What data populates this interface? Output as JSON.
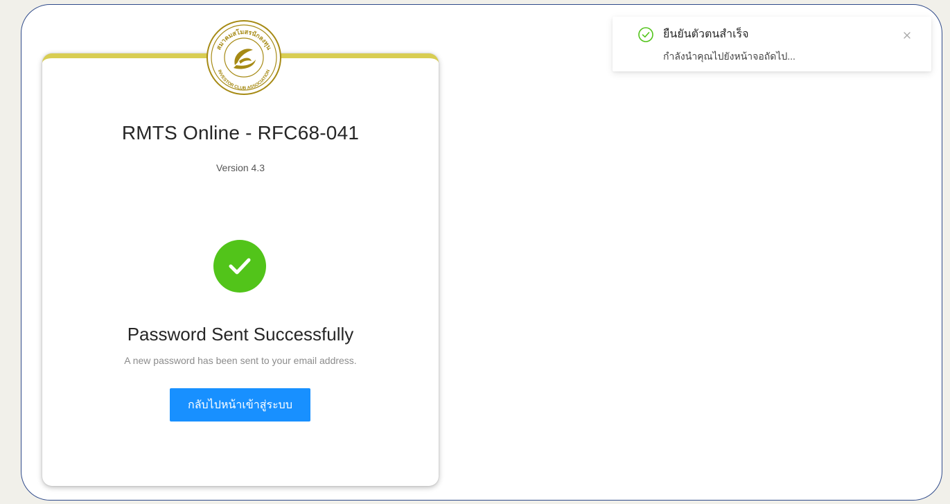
{
  "card": {
    "logo": {
      "icon": "investor-club-association-logo",
      "text_top": "สมาคมสโมสรนักลงทุน",
      "text_bottom": "INVESTOR CLUB ASSOCIATION",
      "color": "#a68a14"
    },
    "app_title": "RMTS Online - RFC68-041",
    "version": "Version 4.3",
    "result": {
      "icon": "check-circle-icon",
      "title": "Password Sent Successfully",
      "subtitle": "A new password has been sent to your email address.",
      "button_label": "กลับไปหน้าเข้าสู่ระบบ"
    }
  },
  "notification": {
    "icon": "check-circle-outline-icon",
    "title": "ยืนยันตัวตนสำเร็จ",
    "description": "กำลังนำคุณไปยังหน้าจอถัดไป...",
    "close_icon": "close-icon"
  },
  "colors": {
    "accent": "#1890ff",
    "success": "#52c41a",
    "card_top_border": "#d8cd52",
    "frame_border": "#2f4a8a"
  }
}
